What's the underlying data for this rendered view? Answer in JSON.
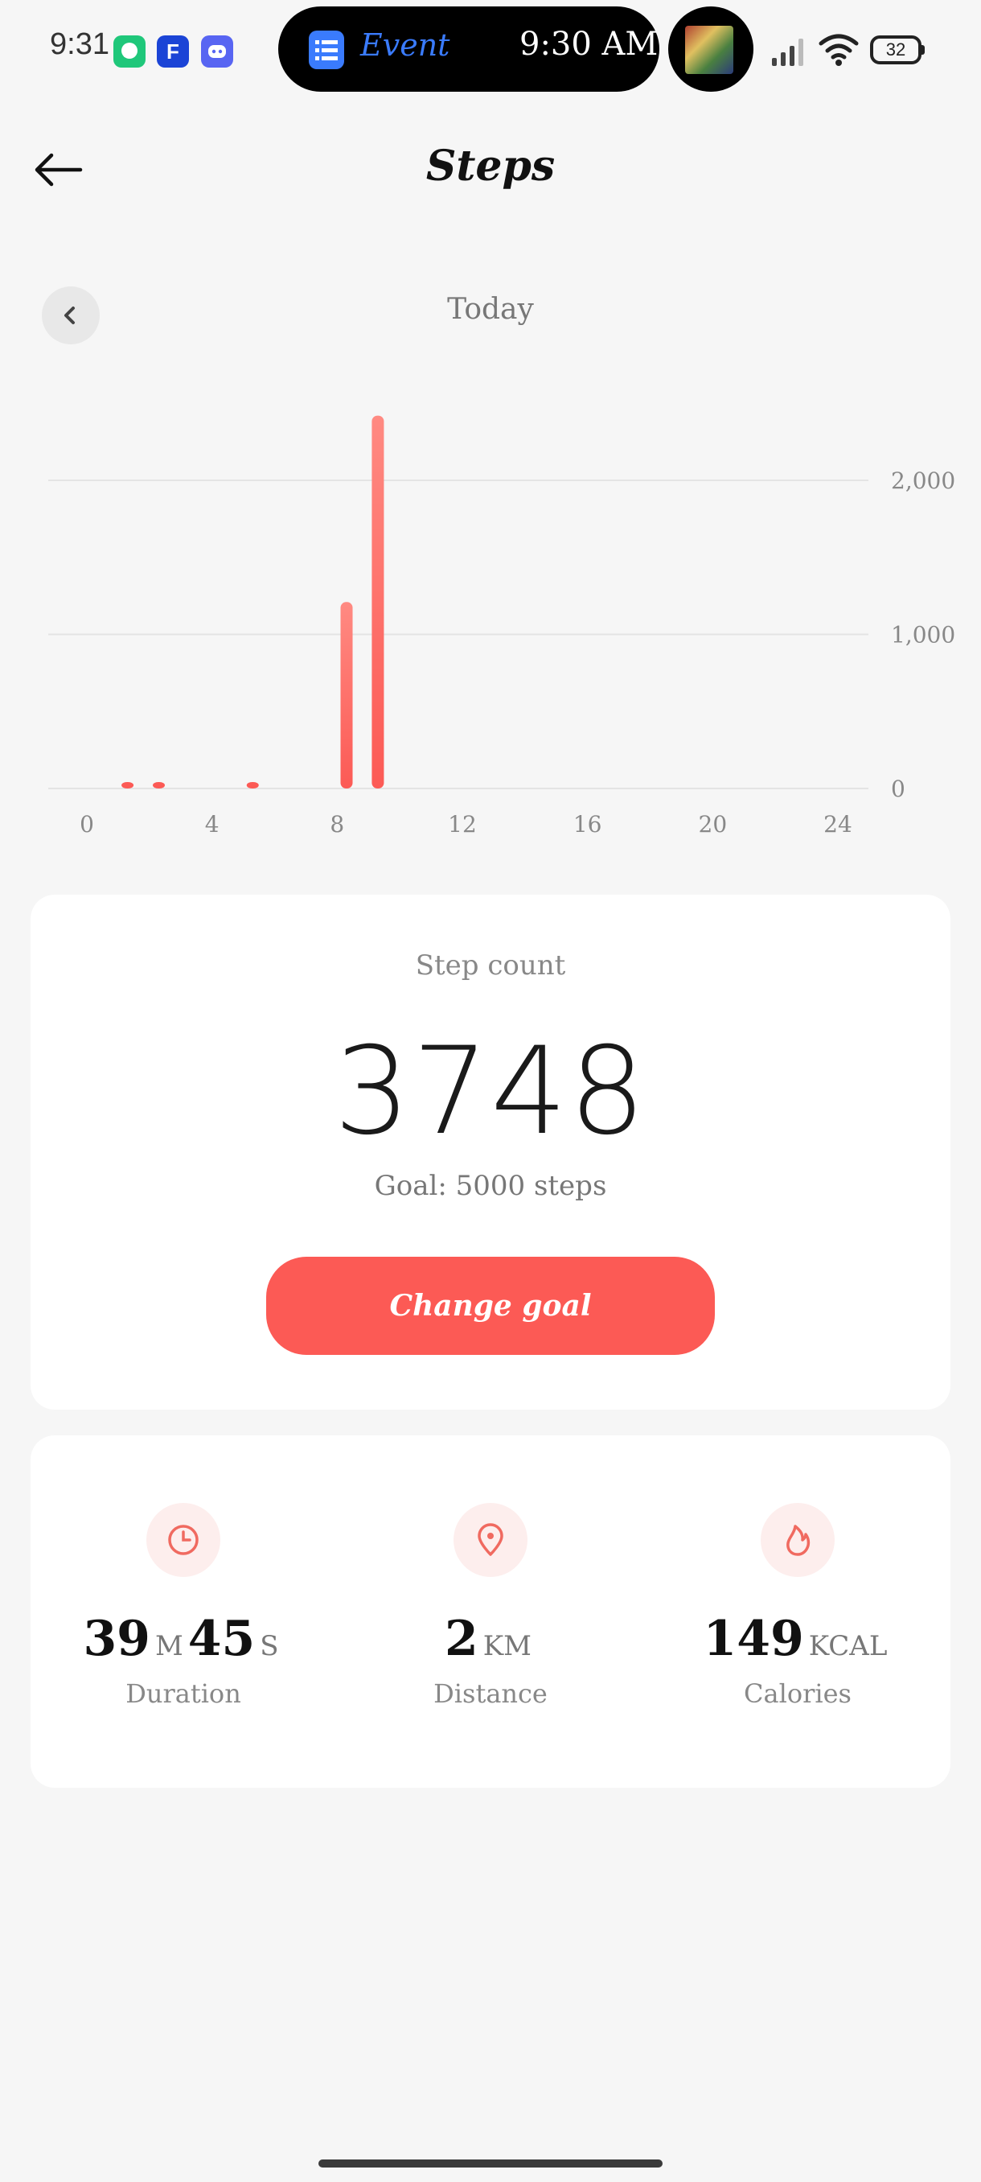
{
  "status_bar": {
    "time": "9:31",
    "event_label": "Event",
    "event_time": "9:30 AM",
    "battery": "32",
    "icons": [
      "chat-app-icon",
      "f-app-icon",
      "discord-icon",
      "signal-icon",
      "wifi-icon",
      "battery-icon"
    ]
  },
  "header": {
    "title": "Steps"
  },
  "chart_nav": {
    "period": "Today"
  },
  "chart_data": {
    "type": "bar",
    "x_ticks": [
      "0",
      "4",
      "8",
      "12",
      "16",
      "20",
      "24"
    ],
    "y_ticks": [
      "0",
      "1,000",
      "2,000"
    ],
    "ylim": [
      0,
      2000
    ],
    "xlim": [
      0,
      24
    ],
    "bars": [
      {
        "hour": 1.3,
        "value": 25
      },
      {
        "hour": 2.3,
        "value": 25
      },
      {
        "hour": 5.3,
        "value": 40
      },
      {
        "hour": 8.3,
        "value": 1210
      },
      {
        "hour": 9.3,
        "value": 2420
      }
    ],
    "bar_color": "#fc5a55",
    "grid": true
  },
  "step_card": {
    "label": "Step count",
    "value": "3748",
    "goal": "Goal: 5000 steps",
    "button": "Change goal"
  },
  "metrics": {
    "duration": {
      "minutes": "39",
      "min_unit": "M",
      "seconds": "45",
      "sec_unit": "S",
      "label": "Duration"
    },
    "distance": {
      "value": "2",
      "unit": "KM",
      "label": "Distance"
    },
    "calories": {
      "value": "149",
      "unit": "KCAL",
      "label": "Calories"
    }
  },
  "colors": {
    "accent": "#fc5a55",
    "background": "#f6f6f6",
    "card": "#ffffff"
  }
}
